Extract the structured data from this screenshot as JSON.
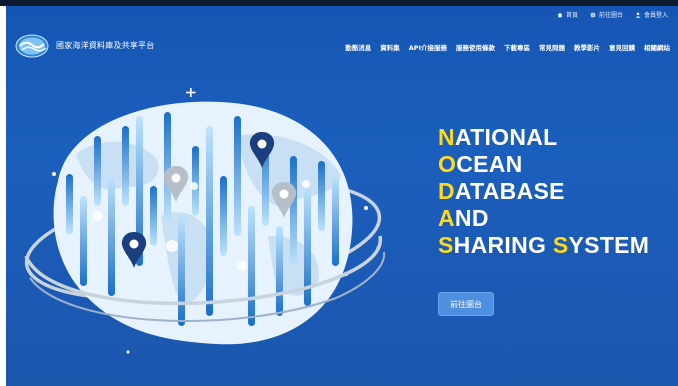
{
  "header": {
    "site_name": "國家海洋資料庫及共享平台",
    "utility_links": [
      {
        "label": "首頁",
        "icon": "home-icon"
      },
      {
        "label": "前往圖台",
        "icon": "globe-icon"
      },
      {
        "label": "會員登入",
        "icon": "user-icon"
      }
    ],
    "nav": [
      {
        "label": "動態消息"
      },
      {
        "label": "資料集"
      },
      {
        "label": "API介接服務"
      },
      {
        "label": "服務使用條款"
      },
      {
        "label": "下載專區"
      },
      {
        "label": "常見問題"
      },
      {
        "label": "教學影片"
      },
      {
        "label": "意見回饋"
      },
      {
        "label": "相關網站"
      }
    ]
  },
  "hero": {
    "title_lines": [
      {
        "initial": "N",
        "rest": "ATIONAL"
      },
      {
        "initial": "O",
        "rest": "CEAN"
      },
      {
        "initial": "D",
        "rest": "ATABASE"
      },
      {
        "initial": "A",
        "rest": "ND"
      },
      {
        "initial": "S",
        "rest": "HARING ",
        "initial2": "S",
        "rest2": "YSTEM"
      }
    ],
    "cta_label": "前往圖台"
  },
  "colors": {
    "background": "#1b5fbd",
    "highlight": "#ffd91a",
    "button": "#4f8fe0"
  }
}
